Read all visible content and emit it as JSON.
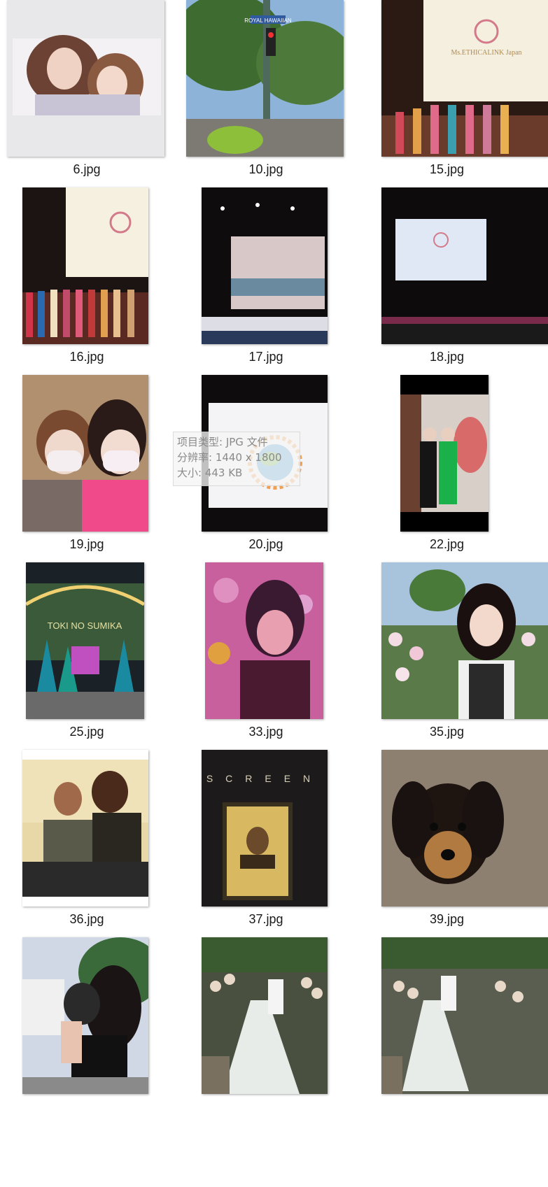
{
  "files": [
    {
      "name": "6.jpg"
    },
    {
      "name": "10.jpg"
    },
    {
      "name": "15.jpg"
    },
    {
      "name": "16.jpg"
    },
    {
      "name": "17.jpg"
    },
    {
      "name": "18.jpg"
    },
    {
      "name": "19.jpg"
    },
    {
      "name": "20.jpg"
    },
    {
      "name": "22.jpg"
    },
    {
      "name": "25.jpg"
    },
    {
      "name": "33.jpg"
    },
    {
      "name": "35.jpg"
    },
    {
      "name": "36.jpg"
    },
    {
      "name": "37.jpg"
    },
    {
      "name": "39.jpg"
    },
    {
      "name": ""
    },
    {
      "name": ""
    },
    {
      "name": ""
    }
  ],
  "tooltip": {
    "type": "项目类型: JPG 文件",
    "resolution": "分辨率: 1440 x 1800",
    "size": "大小: 443 KB"
  },
  "image_text": {
    "street_sign": "ROYAL HAWAIIAN",
    "stage_title": "Ms.ETHICALINK Japan",
    "tunnel_sign": "TOKI NO SUMIKA",
    "screen_text": "SCREEN"
  }
}
